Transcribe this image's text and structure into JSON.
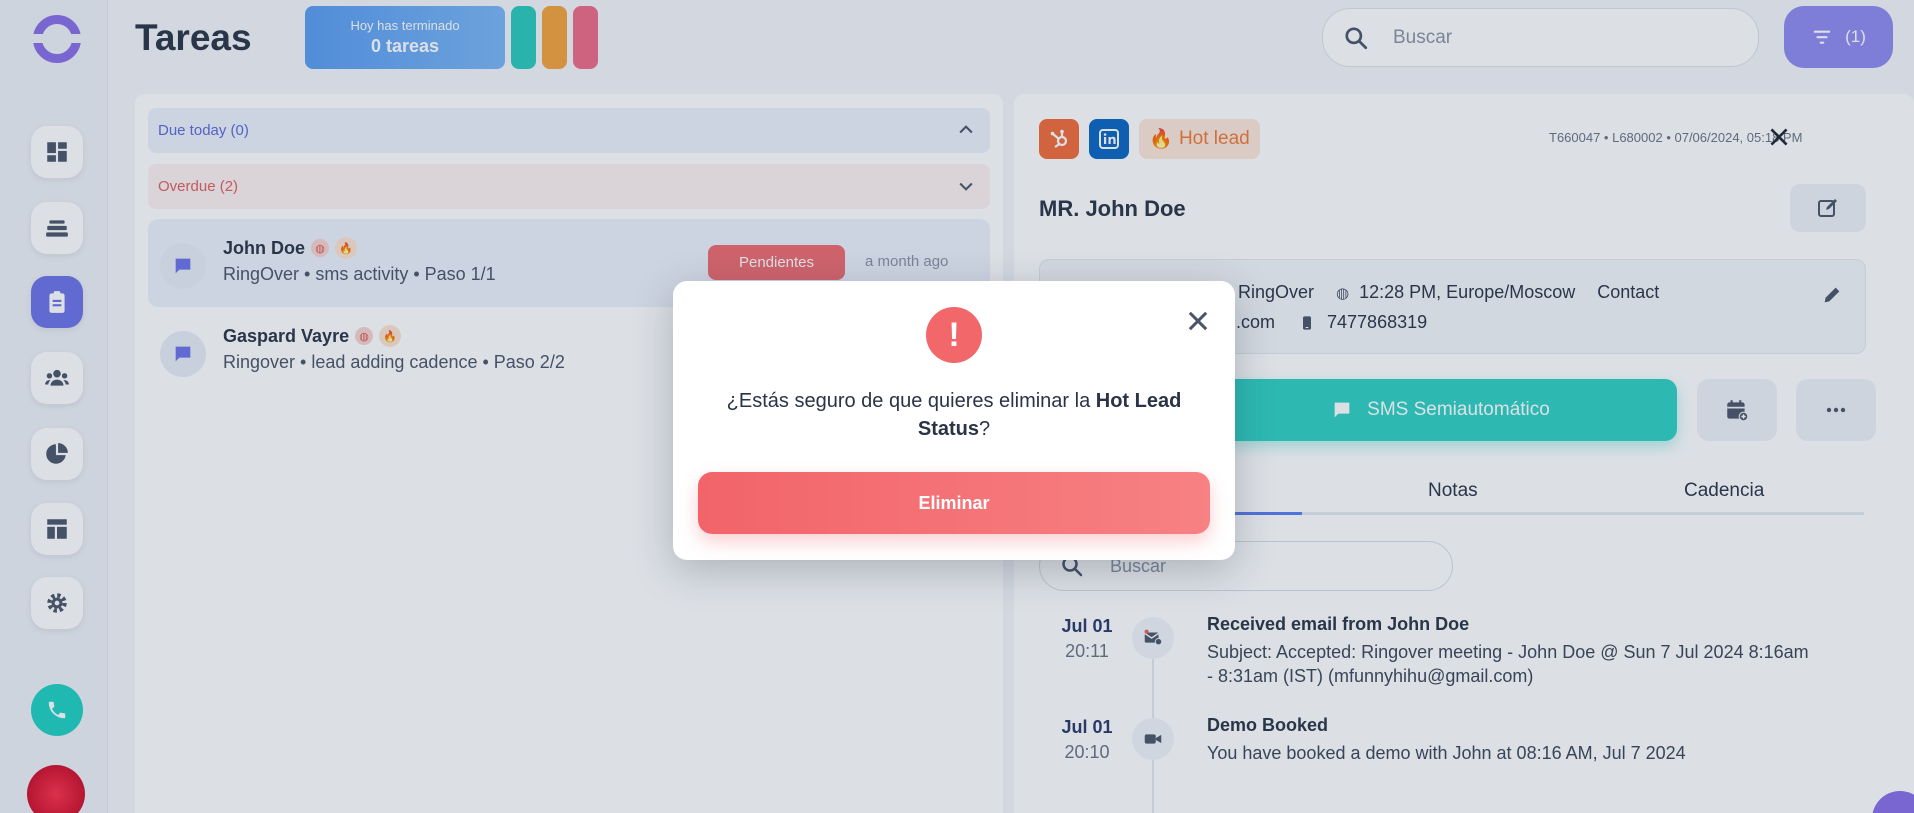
{
  "header": {
    "title": "Tareas",
    "done_label": "Hoy has terminado",
    "done_count": "0 tareas",
    "search_placeholder": "Buscar",
    "filter_label": "(1)"
  },
  "colors": {
    "accent": "#6c73e8",
    "danger": "#f1676a",
    "teal": "#2fd1c3",
    "pill_1": "#2cc9bb",
    "pill_2": "#f3a23a",
    "pill_3": "#ef6b86"
  },
  "groups": [
    {
      "label": "Due today (0)",
      "color": "#5b6bd8"
    },
    {
      "label": "Overdue (2)",
      "color": "#e06060"
    }
  ],
  "tasks": [
    {
      "name": "John Doe",
      "sub": "RingOver • sms activity • Paso 1/1",
      "status": "Pendientes",
      "time": "a month ago"
    },
    {
      "name": "Gaspard Vayre",
      "sub": "Ringover • lead adding cadence • Paso 2/2"
    }
  ],
  "detail": {
    "hot_label": "Hot lead",
    "meta": "T660047 • L680002 • 07/06/2024, 05:18 PM",
    "lead_name": "MR. John Doe",
    "company": "RingOver",
    "local_time": "12:28 PM, Europe/Moscow",
    "type": "Contact",
    "email_fragment": "ail.com",
    "phone": "7477868319",
    "sms_button": "SMS Semiautomático",
    "tabs": [
      "Notas",
      "Cadencia"
    ],
    "search_placeholder": "Buscar",
    "timeline": [
      {
        "date": "Jul 01",
        "hour": "20:11",
        "title": "Received email from John Doe",
        "body": "Subject: Accepted: Ringover meeting - John Doe @ Sun 7 Jul 2024 8:16am - 8:31am (IST) (mfunnyhihu@gmail.com)"
      },
      {
        "date": "Jul 01",
        "hour": "20:10",
        "title": "Demo Booked",
        "body": "You have booked a demo with John at 08:16 AM, Jul 7 2024"
      }
    ]
  },
  "modal": {
    "message_prefix": "¿Estás seguro de que quieres eliminar la ",
    "message_bold": "Hot Lead Status",
    "message_suffix": "?",
    "confirm_label": "Eliminar"
  }
}
